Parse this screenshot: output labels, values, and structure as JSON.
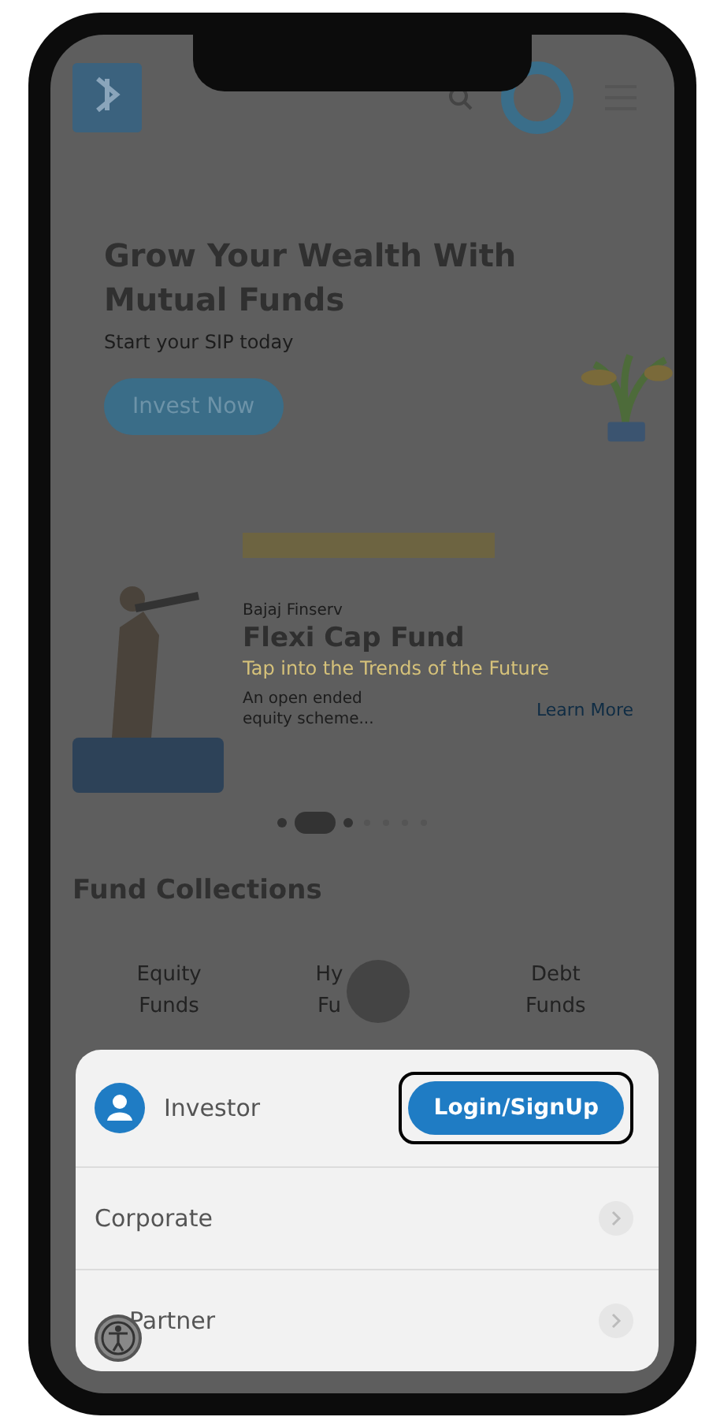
{
  "hero": {
    "title": "Grow Your Wealth With Mutual Funds",
    "subtitle": "Start your SIP today",
    "button": "Invest Now"
  },
  "promo": {
    "brand": "Bajaj Finserv",
    "title": "Flexi Cap Fund",
    "tagline": "Tap into the Trends of the Future",
    "description": "An open ended equity scheme...",
    "link": "Learn More"
  },
  "fund_collections": {
    "title": "Fund Collections",
    "items": [
      {
        "label": "Equity Funds"
      },
      {
        "label": "Hy Fu"
      },
      {
        "label": "Debt Funds"
      }
    ]
  },
  "account_sheet": {
    "rows": [
      {
        "kind": "action",
        "label": "Investor",
        "button": "Login/SignUp"
      },
      {
        "kind": "link",
        "label": "Corporate"
      },
      {
        "kind": "link",
        "label": "Partner"
      }
    ]
  }
}
